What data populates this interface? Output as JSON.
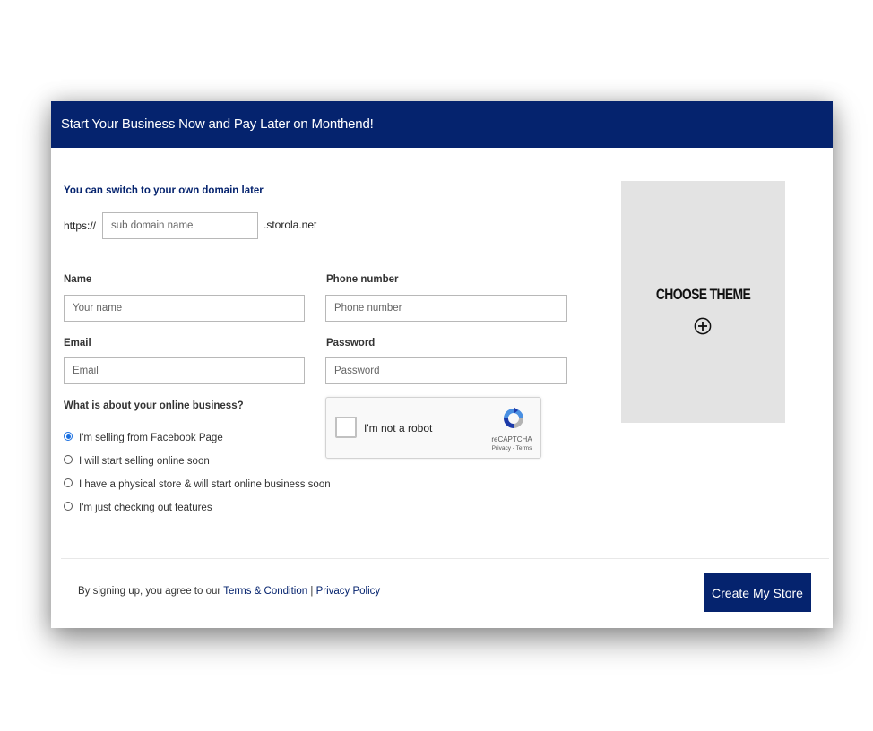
{
  "header": {
    "title": "Start Your Business Now and Pay Later on Monthend!"
  },
  "domain": {
    "hint": "You can switch to your own domain later",
    "prefix": "https://",
    "placeholder": "sub domain name",
    "suffix": ".storola.net"
  },
  "form": {
    "name": {
      "label": "Name",
      "placeholder": "Your name"
    },
    "phone": {
      "label": "Phone number",
      "placeholder": "Phone number"
    },
    "email": {
      "label": "Email",
      "placeholder": "Email"
    },
    "password": {
      "label": "Password",
      "placeholder": "Password"
    }
  },
  "business": {
    "question": "What is about your online business?",
    "options": [
      {
        "label": "I'm selling from Facebook Page",
        "checked": true
      },
      {
        "label": "I will start selling online soon",
        "checked": false
      },
      {
        "label": "I have a physical store & will start online business soon",
        "checked": false
      },
      {
        "label": "I'm just checking out features",
        "checked": false
      }
    ]
  },
  "captcha": {
    "label": "I'm not a robot",
    "brand": "reCAPTCHA",
    "links": "Privacy - Terms"
  },
  "theme": {
    "title": "CHOOSE THEME",
    "icon": "plus-circle-icon"
  },
  "footer": {
    "text": "By signing up, you agree to our",
    "terms": "Terms & Condition",
    "separator": "|",
    "privacy": "Privacy Policy",
    "cta": "Create My Store"
  },
  "colors": {
    "brand": "#05236e",
    "theme_bg": "#e3e3e3",
    "radio_active": "#1a6fe0"
  }
}
